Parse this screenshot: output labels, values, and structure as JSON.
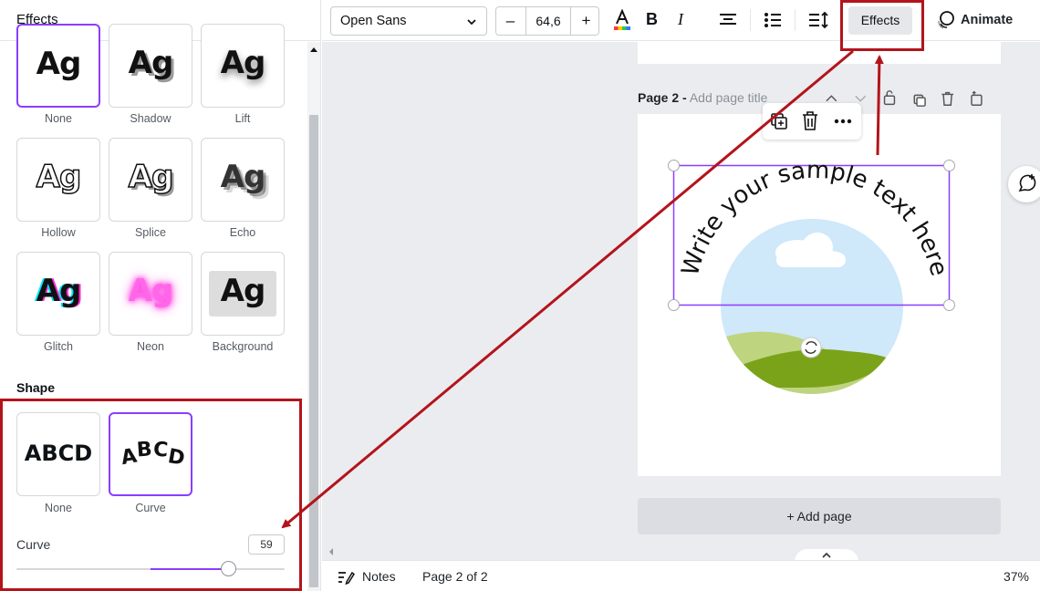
{
  "panel": {
    "title": "Effects",
    "styles": [
      {
        "label": "None",
        "sample": "Ag"
      },
      {
        "label": "Shadow",
        "sample": "Ag"
      },
      {
        "label": "Lift",
        "sample": "Ag"
      },
      {
        "label": "Hollow",
        "sample": "Ag"
      },
      {
        "label": "Splice",
        "sample": "Ag"
      },
      {
        "label": "Echo",
        "sample": "Ag"
      },
      {
        "label": "Glitch",
        "sample": "Ag"
      },
      {
        "label": "Neon",
        "sample": "Ag"
      },
      {
        "label": "Background",
        "sample": "Ag"
      }
    ],
    "shape_title": "Shape",
    "shapes": [
      {
        "label": "None",
        "sample": "ABCD"
      },
      {
        "label": "Curve",
        "sample": "ABCD"
      }
    ],
    "selected_shape": "Curve",
    "curve": {
      "label": "Curve",
      "value": "59",
      "fraction": 0.79,
      "fill_start": 0.5
    }
  },
  "toolbar": {
    "font": "Open Sans",
    "size": "64,6",
    "minus": "–",
    "plus": "+",
    "effects_label": "Effects",
    "animate_label": "Animate"
  },
  "canvas": {
    "page_number": "Page 2 -",
    "page_title_placeholder": "Add page title",
    "curved_text": "Write your sample text here",
    "add_page": "+ Add page"
  },
  "bottombar": {
    "notes": "Notes",
    "page_indicator": "Page 2 of 2",
    "zoom": "37%"
  },
  "colors": {
    "accent": "#8b3dff",
    "annotation": "#b3141b",
    "neon": "#ff3fe0",
    "sky": "#cfe8fa",
    "grass": "#7aa319"
  }
}
